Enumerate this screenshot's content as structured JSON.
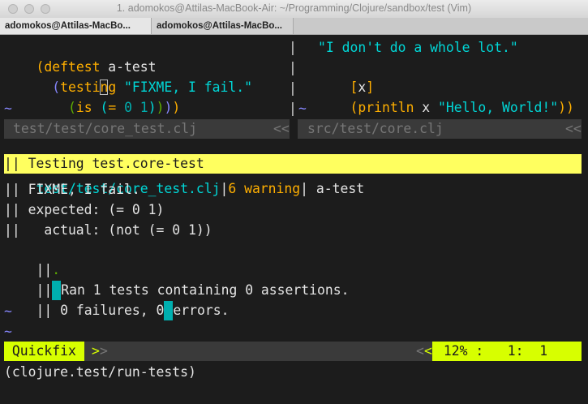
{
  "window": {
    "title": "1. adomokos@Attilas-MacBook-Air: ~/Programming/Clojure/sandbox/test (Vim)",
    "tabs": [
      "adomokos@Attilas-MacBo...",
      "adomokos@Attilas-MacBo..."
    ]
  },
  "left_pane": {
    "line1": [
      "(",
      "deftest",
      " a-test"
    ],
    "line2": [
      "  (",
      "testi",
      "n",
      "g",
      " \"FIXME, I fail.\""
    ],
    "line3": [
      "    (",
      "is",
      " ",
      "(",
      "=",
      " 0 1",
      ")",
      ")",
      ")",
      ")"
    ],
    "tilde": "~",
    "status": "test/test/core_test.clj",
    "status_arrow": "<<"
  },
  "right_pane": {
    "line1": "\"I don't do a whole lot.\"",
    "line2": [
      "[",
      "x",
      "]"
    ],
    "line3": [
      "(",
      "println",
      " x ",
      "\"Hello, World!\"",
      ")",
      ")"
    ],
    "tilde": "~",
    "status": "src/test/core.clj",
    "status_arrow": "<<"
  },
  "separator": "|",
  "quickfix": {
    "header": "|| Testing test.core-test",
    "file_line": {
      "file": "test/test/core_test.clj",
      "bar1": "|",
      "num": "6",
      "kind": " warning",
      "bar2": "|",
      "name": " a-test"
    },
    "lines": [
      "|| FIXME, I fail.",
      "|| expected: (= 0 1)",
      "||   actual: (not (= 0 1))"
    ],
    "dot_line": {
      "bars": "||",
      "dot": "."
    },
    "ran_line": {
      "bars": "||",
      "text": "Ran 1 tests containing 0 assertions."
    },
    "fail_line": {
      "prefix": "|| 0 failures, 0",
      "text": "errors."
    },
    "tildes": [
      "~",
      "~"
    ]
  },
  "bottom_status": {
    "mode": " Quickfix ",
    "mode_arrow": ">",
    "mode_arrow2": ">",
    "left_arrow": "<",
    "left_arrow2": "<",
    "position": " 12% :   1:  1 "
  },
  "command_line": "(clojure.test/run-tests)",
  "colors": {
    "background": "#1c1c1c",
    "keyword": "#ffaf00",
    "string": "#00d7d7",
    "paren_green": "#5faf00",
    "tilde": "#8787ff",
    "highlight_yellow": "#ffff5f",
    "status_lime": "#d7ff00",
    "cursor": "#00afaf"
  }
}
